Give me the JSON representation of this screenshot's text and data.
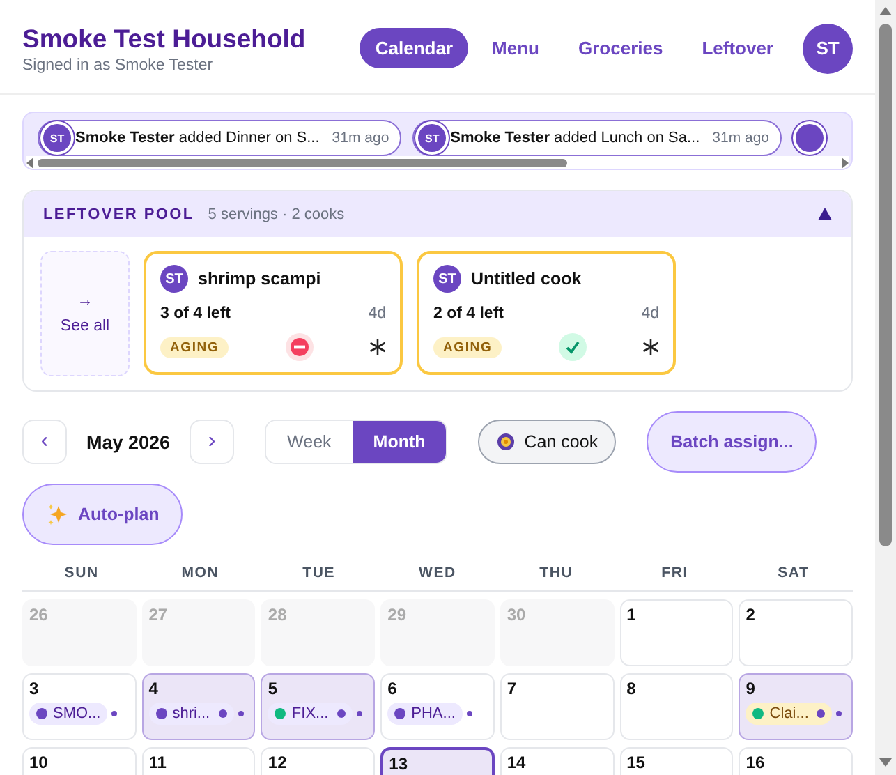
{
  "header": {
    "title": "Smoke Test Household",
    "subtitle": "Signed in as Smoke Tester",
    "avatar": "ST"
  },
  "nav": [
    {
      "label": "Calendar",
      "selected": true
    },
    {
      "label": "Menu",
      "selected": false
    },
    {
      "label": "Groceries",
      "selected": false
    },
    {
      "label": "Leftover",
      "selected": false
    }
  ],
  "activity": [
    {
      "initials": "ST",
      "actor": "Smoke Tester",
      "text": "added Dinner on S...",
      "time": "31m ago"
    },
    {
      "initials": "ST",
      "actor": "Smoke Tester",
      "text": "added Lunch on Sa...",
      "time": "31m ago"
    }
  ],
  "leftover_pool": {
    "title": "LEFTOVER POOL",
    "summary": "5 servings · 2 cooks",
    "expanded": true,
    "see_all": {
      "arrow": "→",
      "label": "See all"
    },
    "cards": [
      {
        "initials": "ST",
        "name": "shrimp scampi",
        "left": "3 of 4 left",
        "age": "4d",
        "badge": "AGING",
        "ok": false,
        "frozen": true
      },
      {
        "initials": "ST",
        "name": "Untitled cook",
        "left": "2 of 4 left",
        "age": "4d",
        "badge": "AGING",
        "ok": true,
        "frozen": true
      }
    ]
  },
  "controls": {
    "prev": "‹",
    "month": "May 2026",
    "next": "›",
    "views": [
      {
        "label": "Week",
        "selected": false
      },
      {
        "label": "Month",
        "selected": true
      }
    ],
    "can_cook": {
      "label": "Can cook",
      "on": false
    },
    "batch": "Batch assign...",
    "autoplan": "Auto-plan"
  },
  "calendar": {
    "weekdays": [
      "SUN",
      "MON",
      "TUE",
      "WED",
      "THU",
      "FRI",
      "SAT"
    ],
    "weeks": [
      [
        {
          "day": "26",
          "in_month": false,
          "highlighted": false,
          "today": false
        },
        {
          "day": "27",
          "in_month": false,
          "highlighted": false,
          "today": false
        },
        {
          "day": "28",
          "in_month": false,
          "highlighted": false,
          "today": false
        },
        {
          "day": "29",
          "in_month": false,
          "highlighted": false,
          "today": false
        },
        {
          "day": "30",
          "in_month": false,
          "highlighted": false,
          "today": false
        },
        {
          "day": "1",
          "in_month": true,
          "highlighted": false,
          "today": false
        },
        {
          "day": "2",
          "in_month": true,
          "highlighted": false,
          "today": false
        }
      ],
      [
        {
          "day": "3",
          "in_month": true,
          "highlighted": false,
          "today": false,
          "meals": [
            {
              "label": "SMO...",
              "color": "#6b46c1",
              "kind": "meal",
              "shared": false
            }
          ]
        },
        {
          "day": "4",
          "in_month": true,
          "highlighted": true,
          "today": false,
          "meals": [
            {
              "label": "shri...",
              "color": "#6b46c1",
              "kind": "meal",
              "shared": true
            }
          ]
        },
        {
          "day": "5",
          "in_month": true,
          "highlighted": true,
          "today": false,
          "meals": [
            {
              "label": "FIX...",
              "color": "#10b981",
              "kind": "meal",
              "shared": true
            }
          ]
        },
        {
          "day": "6",
          "in_month": true,
          "highlighted": false,
          "today": false,
          "meals": [
            {
              "label": "PHA...",
              "color": "#6b46c1",
              "kind": "meal",
              "shared": false
            }
          ]
        },
        {
          "day": "7",
          "in_month": true,
          "highlighted": false,
          "today": false
        },
        {
          "day": "8",
          "in_month": true,
          "highlighted": false,
          "today": false
        },
        {
          "day": "9",
          "in_month": true,
          "highlighted": true,
          "today": false,
          "meals": [
            {
              "label": "Clai...",
              "color": "#10b981",
              "kind": "leftover",
              "shared": true
            }
          ]
        }
      ],
      [
        {
          "day": "10",
          "in_month": true,
          "highlighted": false,
          "today": false
        },
        {
          "day": "11",
          "in_month": true,
          "highlighted": false,
          "today": false
        },
        {
          "day": "12",
          "in_month": true,
          "highlighted": false,
          "today": false
        },
        {
          "day": "13",
          "in_month": true,
          "highlighted": true,
          "today": true
        },
        {
          "day": "14",
          "in_month": true,
          "highlighted": false,
          "today": false
        },
        {
          "day": "15",
          "in_month": true,
          "highlighted": false,
          "today": false
        },
        {
          "day": "16",
          "in_month": true,
          "highlighted": false,
          "today": false
        }
      ]
    ]
  }
}
